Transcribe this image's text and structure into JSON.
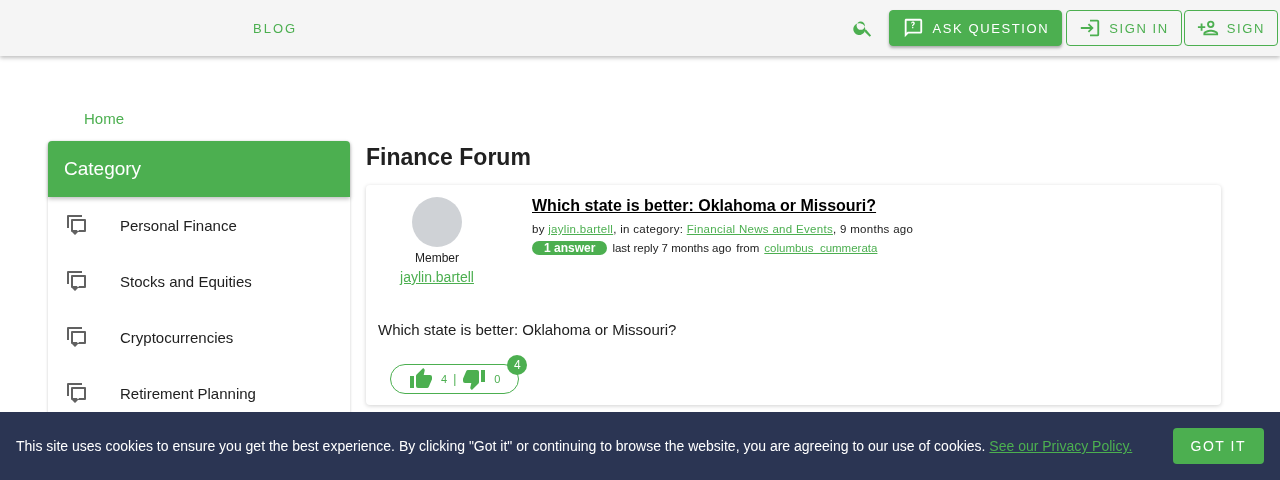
{
  "header": {
    "nav": [
      {
        "label": "BLOG"
      }
    ],
    "buttons": [
      {
        "kind": "ask",
        "label": "ASK QUESTION"
      },
      {
        "kind": "signin",
        "label": "SIGN IN"
      },
      {
        "kind": "signup",
        "label": "SIGN"
      }
    ]
  },
  "breadcrumb": [
    "Home"
  ],
  "sidebar": {
    "title": "Category",
    "items": [
      {
        "label": "Personal Finance"
      },
      {
        "label": "Stocks and Equities"
      },
      {
        "label": "Cryptocurrencies"
      },
      {
        "label": "Retirement Planning"
      }
    ]
  },
  "forum": {
    "title": "Finance Forum",
    "post": {
      "author_role": "Member",
      "author": "jaylin.bartell",
      "title": "Which state is better: Oklahoma or Missouri?",
      "meta_by": "by",
      "meta_author": "jaylin.bartell",
      "meta_in": ", in category:",
      "meta_category": "Financial News and Events",
      "meta_age": ", 9 months ago",
      "answers": "1 answer",
      "last_reply": "last reply 7 months ago",
      "from": "from",
      "last_user": "columbus_cummerata",
      "body": "Which state is better: Oklahoma or Missouri?",
      "likes": "4",
      "separator": "|",
      "dislikes": "0",
      "score": "4"
    }
  },
  "cookie": {
    "text": "This site uses cookies to ensure you get the best experience. By clicking \"Got it\" or continuing to browse the website, you are agreeing to our use of cookies.",
    "link": "See our Privacy Policy.",
    "button": "GOT IT"
  }
}
